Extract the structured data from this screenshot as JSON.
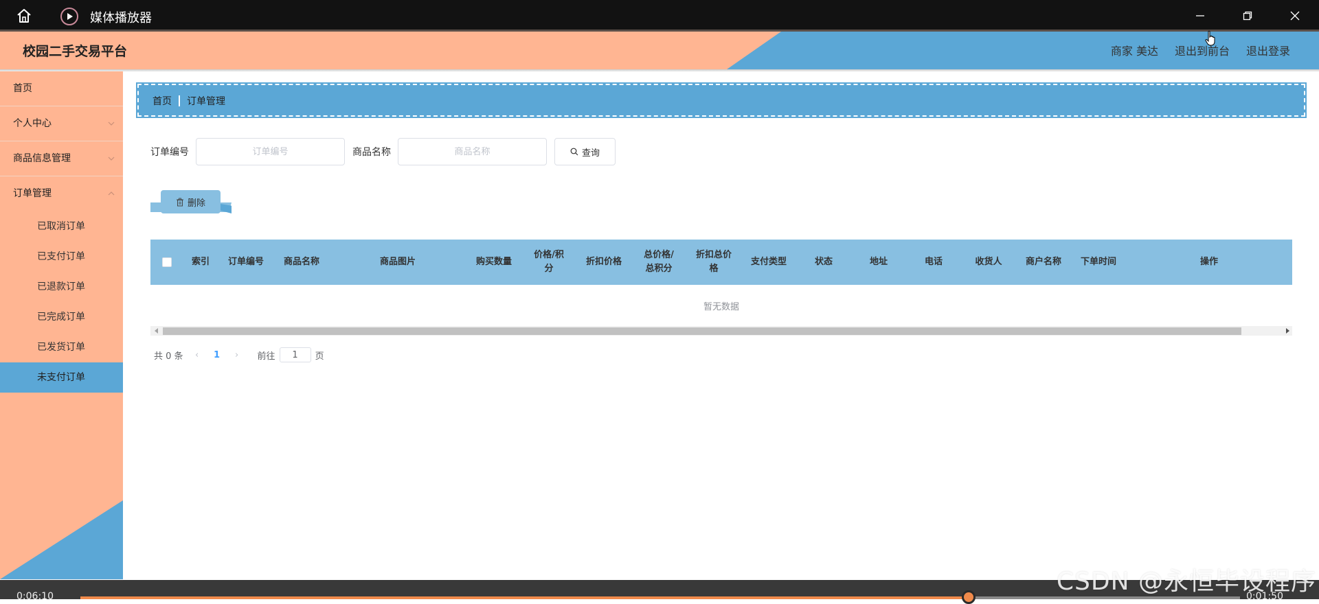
{
  "player": {
    "title": "媒体播放器",
    "current_time": "0:06:10",
    "remaining_time": "0:01:50",
    "progress": 0.766
  },
  "app": {
    "brand": "校园二手交易平台",
    "nav": {
      "user": "商家 美达",
      "back_to_front": "退出到前台",
      "logout": "退出登录"
    }
  },
  "sidebar": {
    "items": [
      {
        "label": "首页"
      },
      {
        "label": "个人中心"
      },
      {
        "label": "商品信息管理"
      },
      {
        "label": "订单管理"
      }
    ],
    "subitems": [
      {
        "label": "已取消订单"
      },
      {
        "label": "已支付订单"
      },
      {
        "label": "已退款订单"
      },
      {
        "label": "已完成订单"
      },
      {
        "label": "已发货订单"
      },
      {
        "label": "未支付订单"
      }
    ]
  },
  "breadcrumb": {
    "home": "首页",
    "current": "订单管理"
  },
  "search": {
    "order_no_label": "订单编号",
    "order_no_placeholder": "订单编号",
    "product_label": "商品名称",
    "product_placeholder": "商品名称",
    "query_button": "查询"
  },
  "actions": {
    "delete_button": "删除"
  },
  "table": {
    "columns": {
      "index": "索引",
      "order_no": "订单编号",
      "product_name": "商品名称",
      "product_image": "商品图片",
      "quantity": "购买数量",
      "price": "价格/积分",
      "discount_price": "折扣价格",
      "total": "总价格/总积分",
      "discount_total": "折扣总价格",
      "pay_type": "支付类型",
      "status": "状态",
      "address": "地址",
      "phone": "电话",
      "receiver": "收货人",
      "merchant": "商户名称",
      "order_time": "下单时间",
      "operation": "操作"
    },
    "empty_text": "暂无数据"
  },
  "pager": {
    "total": "共 0 条",
    "current_page": "1",
    "goto_prefix": "前往",
    "goto_value": "1",
    "goto_suffix": "页"
  },
  "watermark": "CSDN @永恒毕设程序"
}
